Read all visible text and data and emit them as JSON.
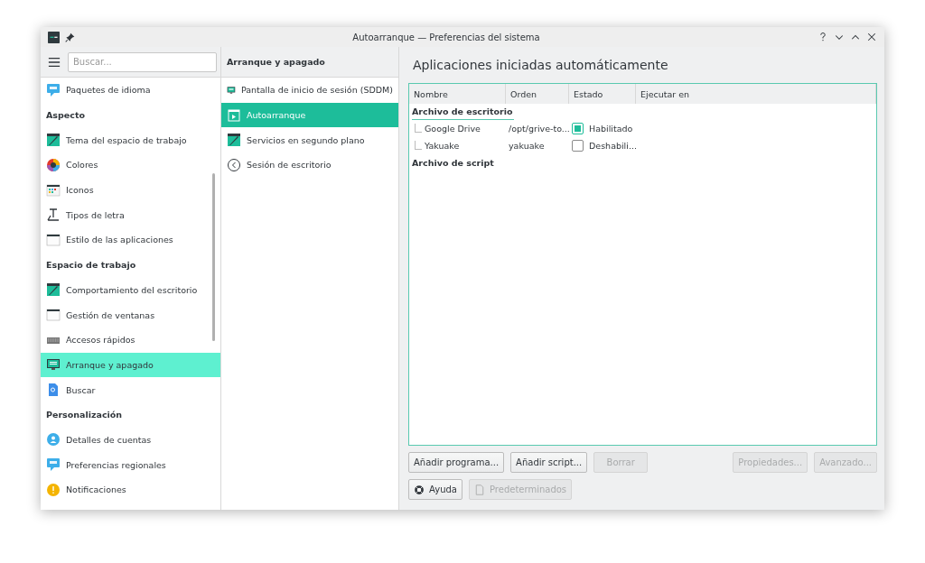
{
  "window": {
    "title": "Autoarranque — Preferencias del sistema"
  },
  "sidebar": {
    "search": {
      "placeholder": "Buscar..."
    },
    "items": [
      {
        "kind": "item",
        "label": "Paquetes de idioma",
        "selected": false
      },
      {
        "kind": "heading",
        "label": "Aspecto"
      },
      {
        "kind": "item",
        "label": "Tema del espacio de trabajo",
        "selected": false
      },
      {
        "kind": "item",
        "label": "Colores",
        "selected": false
      },
      {
        "kind": "item",
        "label": "Iconos",
        "selected": false
      },
      {
        "kind": "item",
        "label": "Tipos de letra",
        "selected": false
      },
      {
        "kind": "item",
        "label": "Estilo de las aplicaciones",
        "selected": false
      },
      {
        "kind": "heading",
        "label": "Espacio de trabajo"
      },
      {
        "kind": "item",
        "label": "Comportamiento del escritorio",
        "selected": false
      },
      {
        "kind": "item",
        "label": "Gestión de ventanas",
        "selected": false
      },
      {
        "kind": "item",
        "label": "Accesos rápidos",
        "selected": false
      },
      {
        "kind": "item",
        "label": "Arranque y apagado",
        "selected": true
      },
      {
        "kind": "item",
        "label": "Buscar",
        "selected": false
      },
      {
        "kind": "heading",
        "label": "Personalización"
      },
      {
        "kind": "item",
        "label": "Detalles de cuentas",
        "selected": false
      },
      {
        "kind": "item",
        "label": "Preferencias regionales",
        "selected": false
      },
      {
        "kind": "item",
        "label": "Notificaciones",
        "selected": false
      }
    ]
  },
  "category": {
    "title": "Arranque y apagado",
    "items": [
      {
        "label": "Pantalla de inicio de sesión (SDDM)",
        "selected": false
      },
      {
        "label": "Autoarranque",
        "selected": true
      },
      {
        "label": "Servicios en segundo plano",
        "selected": false
      },
      {
        "label": "Sesión de escritorio",
        "selected": false
      }
    ]
  },
  "page": {
    "title": "Aplicaciones iniciadas automáticamente",
    "table": {
      "columns": [
        "Nombre",
        "Orden",
        "Estado",
        "Ejecutar en"
      ],
      "groups": [
        {
          "label": "Archivo de escritorio",
          "current": true,
          "children": [
            {
              "name": "Google Drive",
              "command": "/opt/grive-to...",
              "status": "Habilitado",
              "checked": true
            },
            {
              "name": "Yakuake",
              "command": "yakuake",
              "status": "Deshabili...",
              "checked": false
            }
          ]
        },
        {
          "label": "Archivo de script",
          "current": false
        }
      ]
    },
    "buttons": [
      {
        "label": "Añadir programa...",
        "disabled": false
      },
      {
        "label": "Añadir script...",
        "disabled": false
      },
      {
        "label": "Borrar",
        "disabled": true
      }
    ],
    "side_buttons": [
      {
        "label": "Propiedades...",
        "disabled": true
      },
      {
        "label": "Avanzado...",
        "disabled": true
      }
    ],
    "footer_buttons": [
      {
        "label": "Ayuda",
        "disabled": false
      },
      {
        "label": "Predeterminados",
        "disabled": true
      }
    ]
  }
}
